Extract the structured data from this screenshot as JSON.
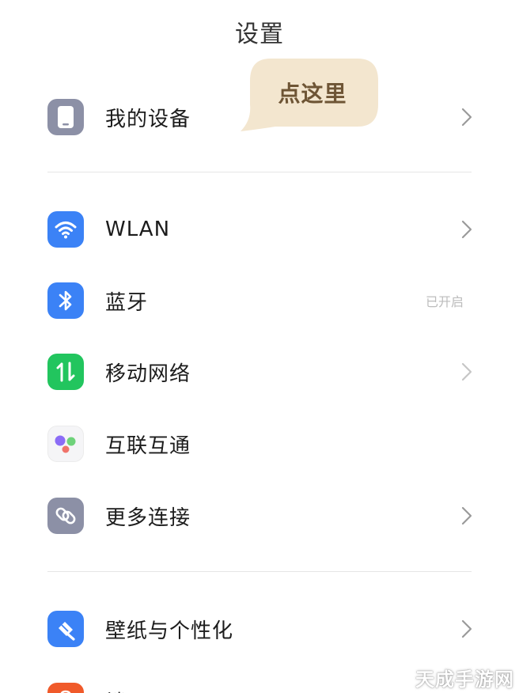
{
  "header": {
    "title": "设置"
  },
  "callout": {
    "text": "点这里"
  },
  "items": [
    {
      "label": "我的设备",
      "icon": "phone-icon"
    },
    {
      "label": "WLAN",
      "icon": "wifi-icon"
    },
    {
      "label": "蓝牙",
      "icon": "bluetooth-icon"
    },
    {
      "label": "移动网络",
      "icon": "mobile-data-icon"
    },
    {
      "label": "互联互通",
      "icon": "interconnect-icon"
    },
    {
      "label": "更多连接",
      "icon": "link-icon"
    },
    {
      "label": "壁纸与个性化",
      "icon": "wallpaper-icon"
    },
    {
      "label": "锁屏",
      "icon": "lock-screen-icon"
    }
  ],
  "bluetooth_status": "已开启",
  "colors": {
    "gray_icon": "#8c90a6",
    "blue_icon": "#3b82f6",
    "green_icon": "#22c55e",
    "orange_icon": "#f05a2a",
    "callout_bg": "#f3e6cf",
    "callout_text": "#6e5535"
  },
  "watermark": {
    "text": "天成手游网"
  }
}
